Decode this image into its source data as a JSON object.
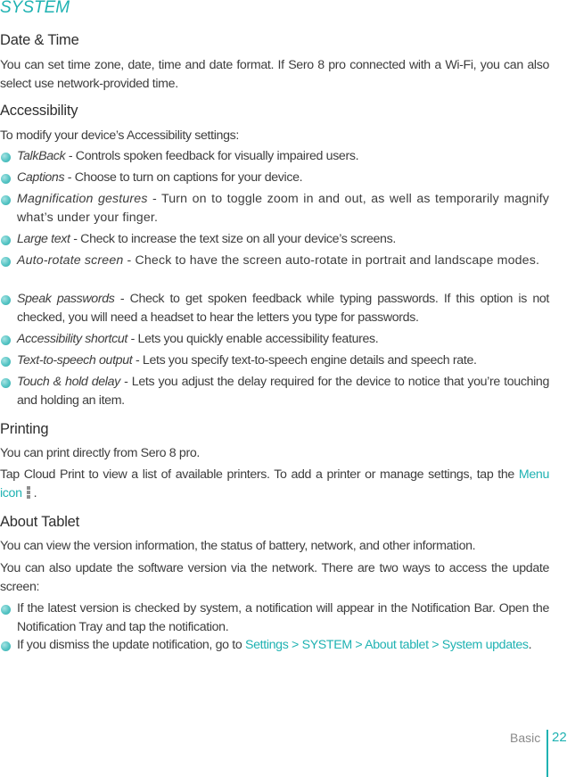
{
  "section_title": "SYSTEM",
  "date_time": {
    "heading": "Date & Time",
    "body": "You can set time zone, date, time and date format. If Sero 8 pro connected with a Wi-Fi, you can also select use network-provided time."
  },
  "accessibility": {
    "heading": "Accessibility",
    "intro": "To modify your device’s Accessibility settings:",
    "items": [
      {
        "term": "TalkBack",
        "desc": " - Controls spoken feedback for visually impaired users."
      },
      {
        "term": "Captions",
        "desc": " - Choose to turn on captions for your device."
      },
      {
        "term": "Magnification gestures",
        "desc": " - Turn on to toggle zoom in and out, as well as temporarily magnify what’s under your finger."
      },
      {
        "term": "Large text",
        "desc": " - Check to increase the text size on all your device’s screens."
      },
      {
        "term": "Auto-rotate screen",
        "desc": " - Check to have the screen auto-rotate in portrait and landscape modes."
      },
      {
        "term": "Speak passwords",
        "desc": " - Check to get spoken feedback while typing passwords. If this option is not checked, you will need a headset to hear the letters you type for passwords."
      },
      {
        "term": "Accessibility shortcut",
        "desc": " - Lets you quickly enable accessibility features."
      },
      {
        "term": "Text-to-speech output",
        "desc": " - Lets you specify text-to-speech engine details and speech rate."
      },
      {
        "term": "Touch & hold delay",
        "desc": " - Lets you adjust the delay required for the device to notice that you’re touching and holding an item."
      }
    ]
  },
  "printing": {
    "heading": "Printing",
    "body1": "You can print directly from Sero 8 pro.",
    "body2_pre": "Tap Cloud Print to view a list of available printers. To add a printer or manage settings, tap the ",
    "body2_link": "Menu icon",
    "body2_icon": "menu-overflow-icon",
    "body2_post": "."
  },
  "about_tablet": {
    "heading": "About Tablet",
    "body1": "You can view the version information, the status of battery, network, and other information.",
    "body2": "You can also update the software version via the network. There are two ways to access the update screen:",
    "items": [
      {
        "text": "If the latest version is checked by system, a notification will appear in the Notification Bar. Open the Notification Tray and tap the notification."
      },
      {
        "pre": "If you dismiss the update notification, go to ",
        "link": "Settings > SYSTEM > About tablet > System updates",
        "post": "."
      }
    ]
  },
  "footer": {
    "label": "Basic",
    "page_number": "22"
  },
  "colors": {
    "accent": "#1fb2b2",
    "text": "#3d3d3d",
    "footer_label": "#8a8a8a",
    "menu_icon": "#8e8e8e"
  }
}
